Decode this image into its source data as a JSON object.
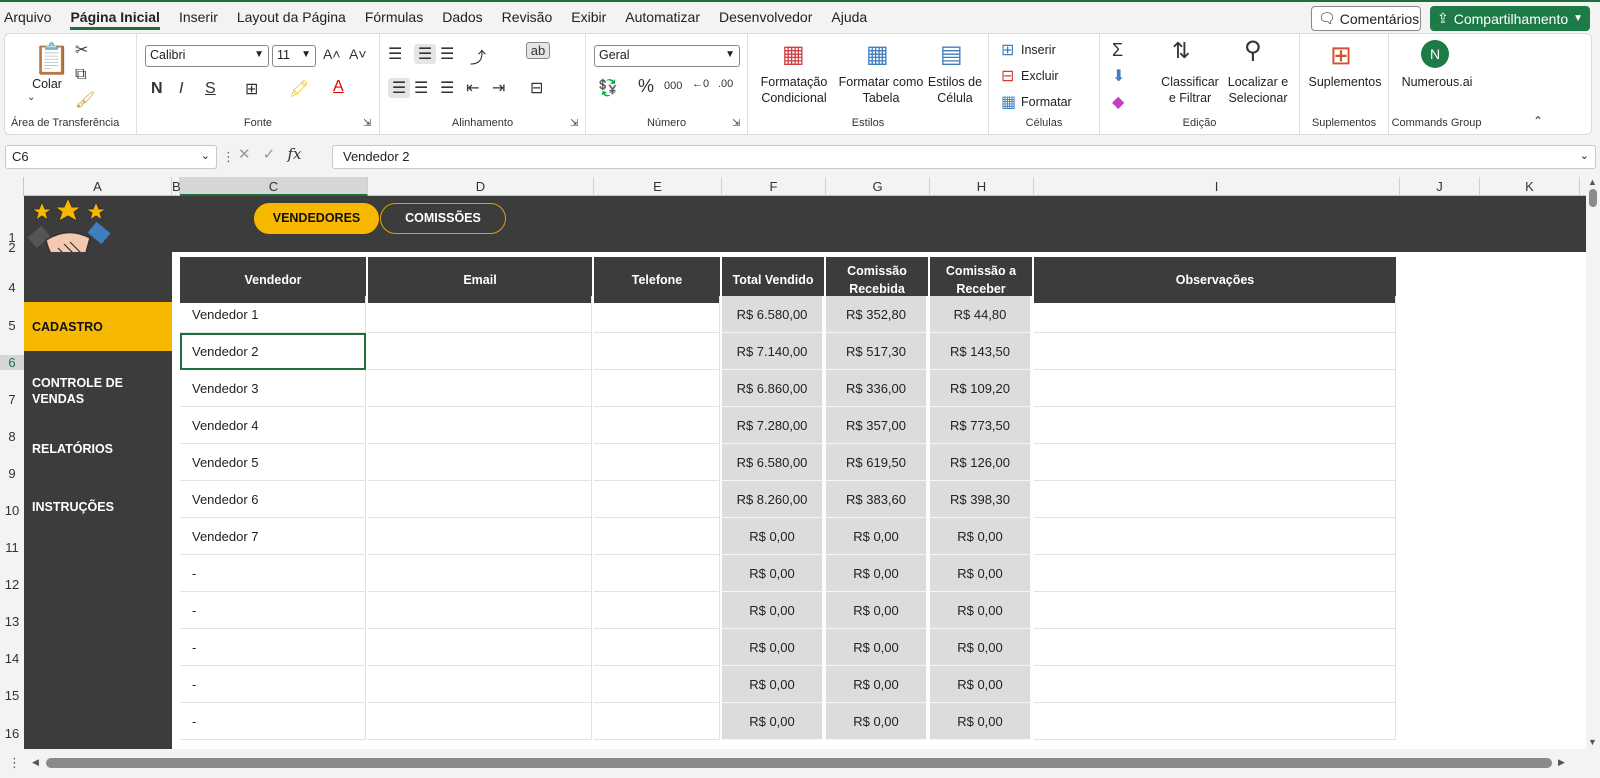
{
  "menu": [
    "Arquivo",
    "Página Inicial",
    "Inserir",
    "Layout da Página",
    "Fórmulas",
    "Dados",
    "Revisão",
    "Exibir",
    "Automatizar",
    "Desenvolvedor",
    "Ajuda"
  ],
  "menu_active": "Página Inicial",
  "top_buttons": {
    "comments": "Comentários",
    "share": "Compartilhamento"
  },
  "ribbon": {
    "clipboard": {
      "paste": "Colar",
      "label": "Área de Transferência"
    },
    "font": {
      "family": "Calibri",
      "size": "11",
      "label": "Fonte"
    },
    "alignment": {
      "label": "Alinhamento"
    },
    "number": {
      "format": "Geral",
      "label": "Número"
    },
    "styles": {
      "cond_format": "Formatação Condicional",
      "format_table": "Formatar como Tabela",
      "cell_styles": "Estilos de Célula",
      "label": "Estilos"
    },
    "cells": {
      "insert": "Inserir",
      "delete": "Excluir",
      "format": "Formatar",
      "label": "Células"
    },
    "editing": {
      "sort": "Classificar e Filtrar",
      "find": "Localizar e Selecionar",
      "label": "Edição"
    },
    "addins": {
      "button": "Suplementos",
      "label": "Suplementos"
    },
    "commands": {
      "button": "Numerous.ai",
      "label": "Commands Group"
    }
  },
  "formula_bar": {
    "cell_ref": "C6",
    "fx": "fx",
    "value": "Vendedor 2"
  },
  "columns": [
    "A",
    "B",
    "C",
    "D",
    "E",
    "F",
    "G",
    "H",
    "I",
    "J",
    "K"
  ],
  "rows": [
    "1",
    "2",
    "4",
    "5",
    "6",
    "7",
    "8",
    "9",
    "10",
    "11",
    "12",
    "13",
    "14",
    "15",
    "16"
  ],
  "nav_tabs": {
    "vendedores": "VENDEDORES",
    "comissoes": "COMISSÕES"
  },
  "sidebar": [
    "CADASTRO",
    "CONTROLE DE VENDAS",
    "RELATÓRIOS",
    "INSTRUÇÕES"
  ],
  "table": {
    "headers": [
      "Vendedor",
      "Email",
      "Telefone",
      "Total Vendido",
      "Comissão Recebida",
      "Comissão a Receber",
      "Observações"
    ],
    "rows": [
      [
        "Vendedor 1",
        "",
        "",
        "R$ 6.580,00",
        "R$ 352,80",
        "R$ 44,80",
        ""
      ],
      [
        "Vendedor 2",
        "",
        "",
        "R$ 7.140,00",
        "R$ 517,30",
        "R$ 143,50",
        ""
      ],
      [
        "Vendedor 3",
        "",
        "",
        "R$ 6.860,00",
        "R$ 336,00",
        "R$ 109,20",
        ""
      ],
      [
        "Vendedor 4",
        "",
        "",
        "R$ 7.280,00",
        "R$ 357,00",
        "R$ 773,50",
        ""
      ],
      [
        "Vendedor 5",
        "",
        "",
        "R$ 6.580,00",
        "R$ 619,50",
        "R$ 126,00",
        ""
      ],
      [
        "Vendedor 6",
        "",
        "",
        "R$ 8.260,00",
        "R$ 383,60",
        "R$ 398,30",
        ""
      ],
      [
        "Vendedor 7",
        "",
        "",
        "R$ 0,00",
        "R$ 0,00",
        "R$ 0,00",
        ""
      ],
      [
        "-",
        "",
        "",
        "R$ 0,00",
        "R$ 0,00",
        "R$ 0,00",
        ""
      ],
      [
        "-",
        "",
        "",
        "R$ 0,00",
        "R$ 0,00",
        "R$ 0,00",
        ""
      ],
      [
        "-",
        "",
        "",
        "R$ 0,00",
        "R$ 0,00",
        "R$ 0,00",
        ""
      ],
      [
        "-",
        "",
        "",
        "R$ 0,00",
        "R$ 0,00",
        "R$ 0,00",
        ""
      ],
      [
        "-",
        "",
        "",
        "R$ 0,00",
        "R$ 0,00",
        "R$ 0,00",
        ""
      ]
    ]
  },
  "colors": {
    "accent": "#f7b900",
    "dark": "#3c3c3c",
    "excel_green": "#1e7a46"
  }
}
